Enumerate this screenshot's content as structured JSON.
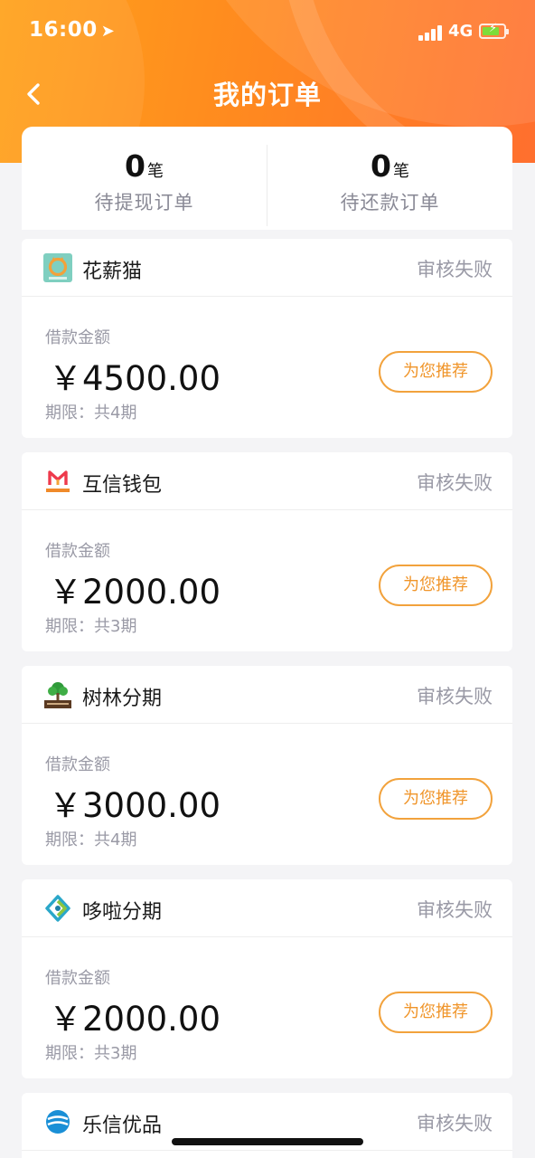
{
  "status_bar": {
    "time": "16:00",
    "network": "4G",
    "icons": [
      "location-arrow-icon",
      "signal-icon",
      "battery-charging-icon"
    ],
    "battery_color": "#7ddc3a"
  },
  "header": {
    "title": "我的订单",
    "back_icon": "chevron-left-icon",
    "gradient": [
      "#ffa21a",
      "#ff6f2e"
    ]
  },
  "summary": {
    "pending_withdraw": {
      "count": "0",
      "unit": "笔",
      "label": "待提现订单"
    },
    "pending_repay": {
      "count": "0",
      "unit": "笔",
      "label": "待还款订单"
    }
  },
  "orders": [
    {
      "name": "花薪猫",
      "status": "审核失败",
      "amount_label": "借款金额",
      "amount": "￥4500.00",
      "term": "期限：共4期",
      "button": "为您推荐",
      "logo_icon": "huaxinmao-logo-icon"
    },
    {
      "name": "互信钱包",
      "status": "审核失败",
      "amount_label": "借款金额",
      "amount": "￥2000.00",
      "term": "期限：共3期",
      "button": "为您推荐",
      "logo_icon": "huxin-wallet-logo-icon"
    },
    {
      "name": "树林分期",
      "status": "审核失败",
      "amount_label": "借款金额",
      "amount": "￥3000.00",
      "term": "期限：共4期",
      "button": "为您推荐",
      "logo_icon": "tree-logo-icon"
    },
    {
      "name": "哆啦分期",
      "status": "审核失败",
      "amount_label": "借款金额",
      "amount": "￥2000.00",
      "term": "期限：共3期",
      "button": "为您推荐",
      "logo_icon": "duola-logo-icon"
    },
    {
      "name": "乐信优品",
      "status": "审核失败",
      "logo_icon": "lexin-logo-icon"
    }
  ],
  "colors": {
    "accent": "#f0952a",
    "status_text": "#9a9aa6"
  }
}
